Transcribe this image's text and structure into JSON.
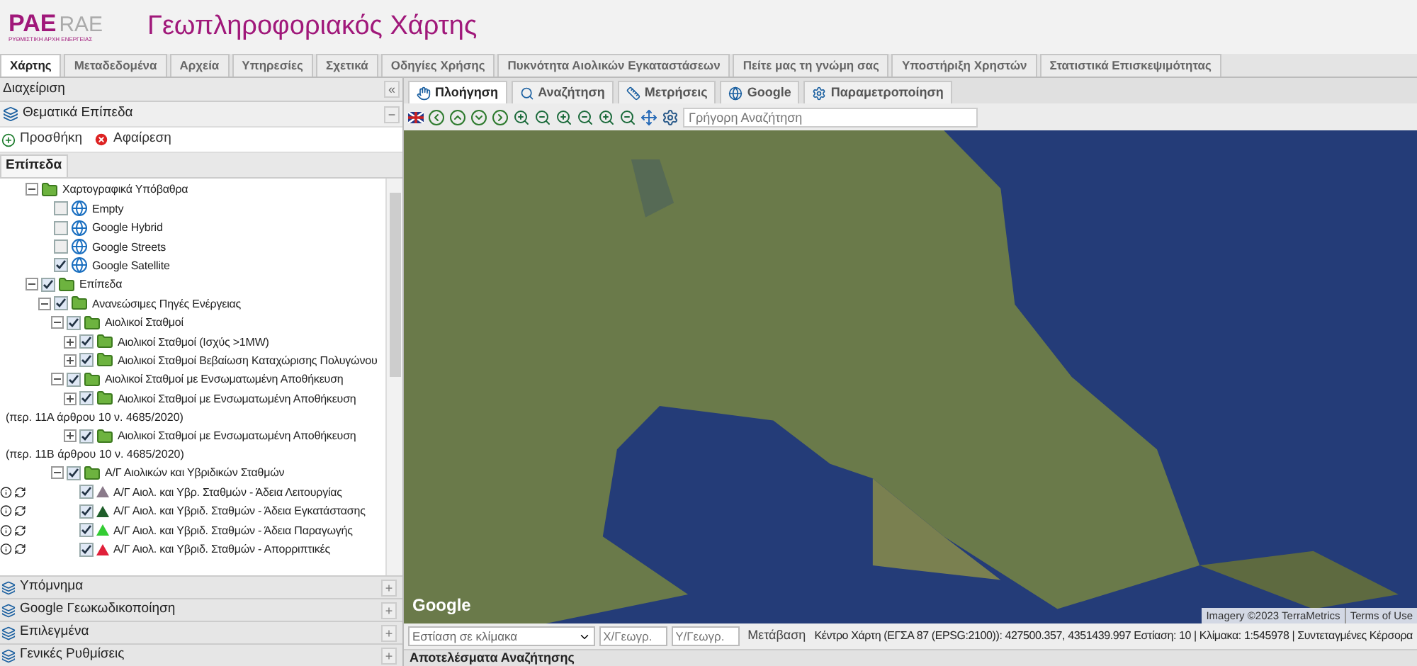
{
  "header": {
    "logo_primary": "PAE",
    "logo_secondary": "RAE",
    "logo_caption": "ΡΥΘΜΙΣΤΙΚΗ ΑΡΧΗ ΕΝΕΡΓΕΙΑΣ",
    "title": "Γεωπληροφοριακός Χάρτης"
  },
  "main_tabs": [
    {
      "label": "Χάρτης",
      "selected": true
    },
    {
      "label": "Μεταδεδομένα",
      "selected": false
    },
    {
      "label": "Αρχεία",
      "selected": false
    },
    {
      "label": "Υπηρεσίες",
      "selected": false
    },
    {
      "label": "Σχετικά",
      "selected": false
    },
    {
      "label": "Οδηγίες Χρήσης",
      "selected": false
    },
    {
      "label": "Πυκνότητα Αιολικών Εγκαταστάσεων",
      "selected": false
    },
    {
      "label": "Πείτε μας τη γνώμη σας",
      "selected": false
    },
    {
      "label": "Υποστήριξη Χρηστών",
      "selected": false
    },
    {
      "label": "Στατιστικά Επισκεψιμότητας",
      "selected": false
    }
  ],
  "sidebar": {
    "title": "Διαχείριση",
    "collapse": "«",
    "section": "Θεματικά Επίπεδα",
    "section_toggle": "−",
    "add": "Προσθήκη",
    "remove": "Αφαίρεση",
    "tab": "Επίπεδα",
    "tree": [
      {
        "label": "Χαρτογραφικά Υπόβαθρα",
        "kind": "folder",
        "expanded": true,
        "children": [
          {
            "label": "Empty",
            "kind": "basemap",
            "checked": false
          },
          {
            "label": "Google Hybrid",
            "kind": "basemap",
            "checked": false
          },
          {
            "label": "Google Streets",
            "kind": "basemap",
            "checked": false
          },
          {
            "label": "Google Satellite",
            "kind": "basemap",
            "checked": true
          }
        ]
      },
      {
        "label": "Επίπεδα",
        "kind": "folder",
        "checked": true,
        "expanded": true,
        "children": [
          {
            "label": "Ανανεώσιμες Πηγές Ενέργειας",
            "kind": "folder",
            "checked": true,
            "expanded": true,
            "children": [
              {
                "label": "Αιολικοί Σταθμοί",
                "kind": "folder",
                "checked": true,
                "expanded": true,
                "children": [
                  {
                    "label": "Αιολικοί Σταθμοί (Ισχύς >1MW)",
                    "kind": "folder",
                    "checked": true,
                    "expanded": false
                  },
                  {
                    "label": "Αιολικοί Σταθμοί Βεβαίωση Καταχώρισης Πολυγώνου",
                    "kind": "folder",
                    "checked": true,
                    "expanded": false
                  }
                ]
              },
              {
                "label": "Αιολικοί Σταθμοί με Ενσωματωμένη Αποθήκευση",
                "kind": "folder",
                "checked": true,
                "expanded": true,
                "children": [
                  {
                    "label": "Αιολικοί Σταθμοί με Ενσωματωμένη Αποθήκευση",
                    "note": "(περ. 11Α άρθρου 10 ν. 4685/2020)",
                    "kind": "folder",
                    "checked": true,
                    "expanded": false
                  },
                  {
                    "label": "Αιολικοί Σταθμοί με Ενσωματωμένη Αποθήκευση",
                    "note": "(περ. 11Β άρθρου 10 ν. 4685/2020)",
                    "kind": "folder",
                    "checked": true,
                    "expanded": false
                  }
                ]
              },
              {
                "label": "Α/Γ Αιολικών και Υβριδικών Σταθμών",
                "kind": "folder",
                "checked": true,
                "expanded": true,
                "children": [
                  {
                    "label": "Α/Γ Αιολ. και Υβρ. Σταθμών - Άδεια Λειτουργίας",
                    "kind": "layer",
                    "checked": true,
                    "color": "#8a7a8a"
                  },
                  {
                    "label": "Α/Γ Αιολ. και Υβριδ. Σταθμών - Άδεια Εγκατάστασης",
                    "kind": "layer",
                    "checked": true,
                    "color": "#1f5e2a"
                  },
                  {
                    "label": "Α/Γ Αιολ. και Υβριδ. Σταθμών - Άδεια Παραγωγής",
                    "kind": "layer",
                    "checked": true,
                    "color": "#33cc33"
                  },
                  {
                    "label": "Α/Γ Αιολ. και Υβριδ. Σταθμών - Απορριπτικές",
                    "kind": "layer",
                    "checked": true,
                    "color": "#e0203a"
                  }
                ]
              }
            ]
          }
        ]
      }
    ],
    "panels": [
      {
        "label": "Υπόμνημα",
        "toggle": "+"
      },
      {
        "label": "Google Γεωκωδικοποίηση",
        "toggle": "+"
      },
      {
        "label": "Επιλεγμένα",
        "toggle": "+"
      },
      {
        "label": "Γενικές Ρυθμίσεις",
        "toggle": "+"
      }
    ]
  },
  "map": {
    "tabs": [
      {
        "label": "Πλοήγηση",
        "selected": true
      },
      {
        "label": "Αναζήτηση",
        "selected": false
      },
      {
        "label": "Μετρήσεις",
        "selected": false
      },
      {
        "label": "Google",
        "selected": false
      },
      {
        "label": "Παραμετροποίηση",
        "selected": false
      }
    ],
    "quick_search": {
      "placeholder": "Γρήγορη Αναζήτηση"
    },
    "google_logo": "Google",
    "attribution": "Imagery ©2023 TerraMetrics",
    "terms": "Terms of Use",
    "scale_select": {
      "placeholder": "Εστίαση σε κλίμακα"
    },
    "x_field": {
      "placeholder": "Χ/Γεωγρ."
    },
    "y_field": {
      "placeholder": "Υ/Γεωγρ."
    },
    "go_button": "Μετάβαση",
    "status": "Κέντρο Χάρτη (ΕΓΣΑ 87 (EPSG:2100)): 427500.357, 4351439.997 Εστίαση: 10 | Κλίμακα: 1:545978 | Συντεταγμένες Κέρσορα",
    "results_title": "Αποτελέσματα Αναζήτησης"
  }
}
